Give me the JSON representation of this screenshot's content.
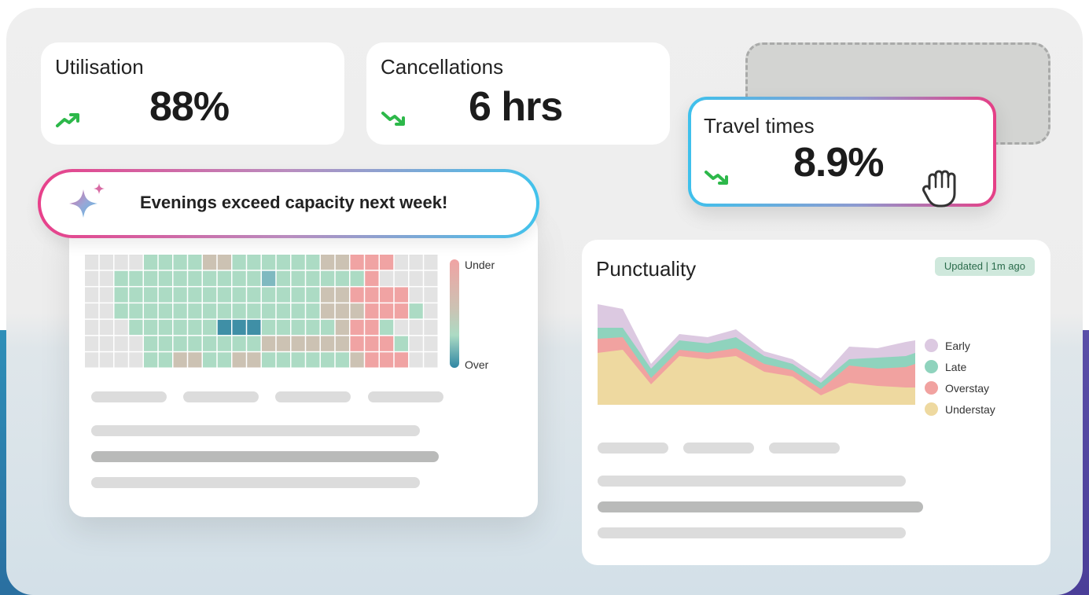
{
  "kpis": {
    "utilisation": {
      "label": "Utilisation",
      "value": "88%",
      "trend": "up"
    },
    "cancellations": {
      "label": "Cancellations",
      "value": "6 hrs",
      "trend": "down"
    },
    "travel_times": {
      "label": "Travel times",
      "value": "8.9%",
      "trend": "down"
    }
  },
  "alert": {
    "message": "Evenings exceed capacity next week!",
    "icon": "sparkle-icon"
  },
  "heatmap": {
    "scale_high": "Under",
    "scale_low": "Over",
    "colors": {
      "under": "#f0a3a3",
      "neutral": "#ccc2b3",
      "good": "#acdbc4",
      "over": "#3f8fa6",
      "empty": "#e3e3e3"
    }
  },
  "punctuality": {
    "title": "Punctuality",
    "badge": "Updated | 1m ago",
    "legend": [
      {
        "name": "Early",
        "color": "#dcc9e1"
      },
      {
        "name": "Late",
        "color": "#8fd3bd"
      },
      {
        "name": "Overstay",
        "color": "#f1a2a0"
      },
      {
        "name": "Understay",
        "color": "#eed9a0"
      }
    ]
  },
  "cursor": {
    "icon": "hand-cursor-icon"
  },
  "colors": {
    "trend_up": "#2db84a",
    "trend_down": "#2db84a",
    "accent_pink": "#e63f86",
    "accent_blue": "#3ec1ec"
  }
}
